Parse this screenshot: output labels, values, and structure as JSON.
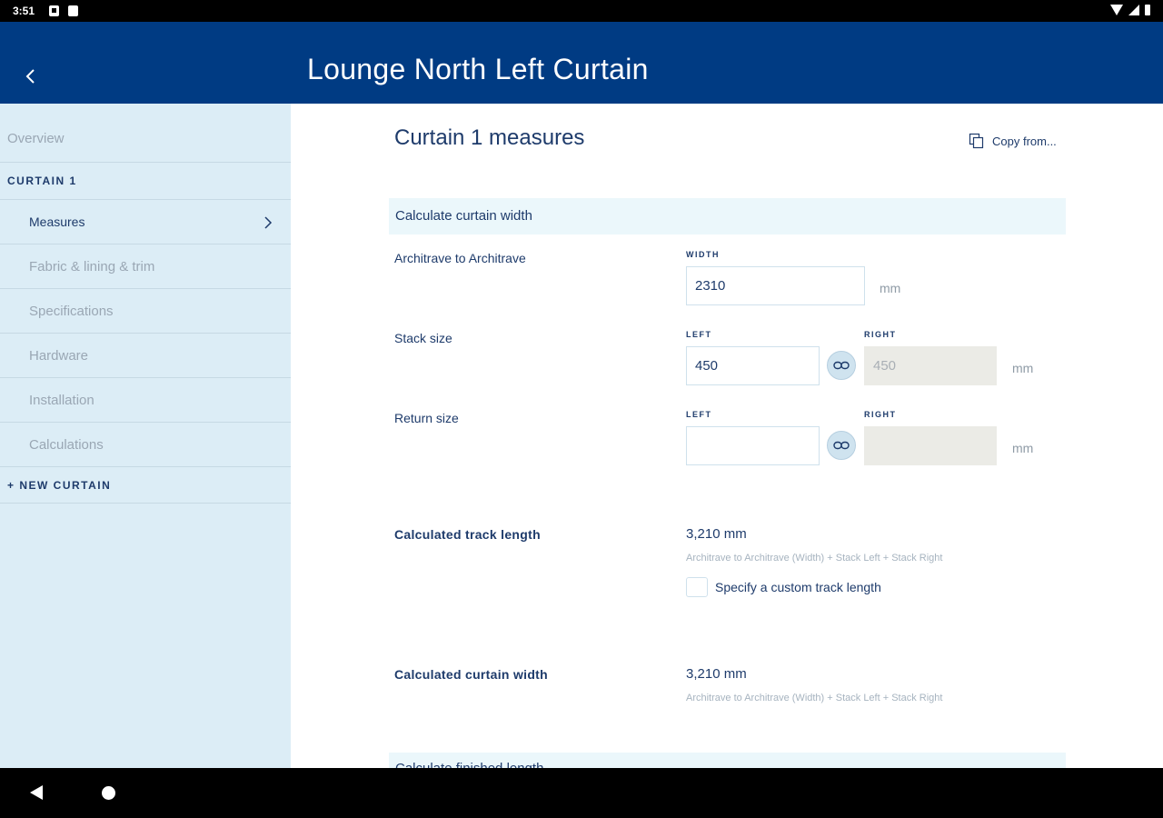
{
  "status_bar": {
    "time": "3:51"
  },
  "app_bar": {
    "title": "Lounge North Left Curtain"
  },
  "sidebar": {
    "overview": "Overview",
    "curtain_heading": "CURTAIN 1",
    "items": [
      {
        "label": "Measures",
        "active": true
      },
      {
        "label": "Fabric & lining & trim"
      },
      {
        "label": "Specifications"
      },
      {
        "label": "Hardware"
      },
      {
        "label": "Installation"
      },
      {
        "label": "Calculations"
      }
    ],
    "new_curtain": "+ NEW CURTAIN"
  },
  "main": {
    "title": "Curtain 1 measures",
    "copy_from": "Copy from...",
    "section_width_title": "Calculate curtain width",
    "architrave": {
      "label": "Architrave to Architrave",
      "caption": "WIDTH",
      "value": "2310",
      "unit": "mm"
    },
    "stack": {
      "label": "Stack size",
      "left_caption": "LEFT",
      "right_caption": "RIGHT",
      "left_value": "450",
      "right_value": "450",
      "unit": "mm",
      "link_icon": "link-icon"
    },
    "return": {
      "label": "Return size",
      "left_caption": "LEFT",
      "right_caption": "RIGHT",
      "left_value": "",
      "right_value": "",
      "unit": "mm",
      "link_icon": "link-icon"
    },
    "track_length": {
      "label": "Calculated track length",
      "value": "3,210 mm",
      "formula": "Architrave to Architrave (Width) + Stack Left + Stack Right",
      "checkbox_label": "Specify a custom track length",
      "checked": false
    },
    "curtain_width": {
      "label": "Calculated curtain width",
      "value": "3,210 mm",
      "formula": "Architrave to Architrave (Width) + Stack Left + Stack Right"
    },
    "next_section_title": "Calculate finished length"
  },
  "colors": {
    "app_bar": "#003b83",
    "sidebar": "#dcedf6",
    "section_band": "#ebf7fb",
    "text_primary": "#1e3b6b"
  }
}
